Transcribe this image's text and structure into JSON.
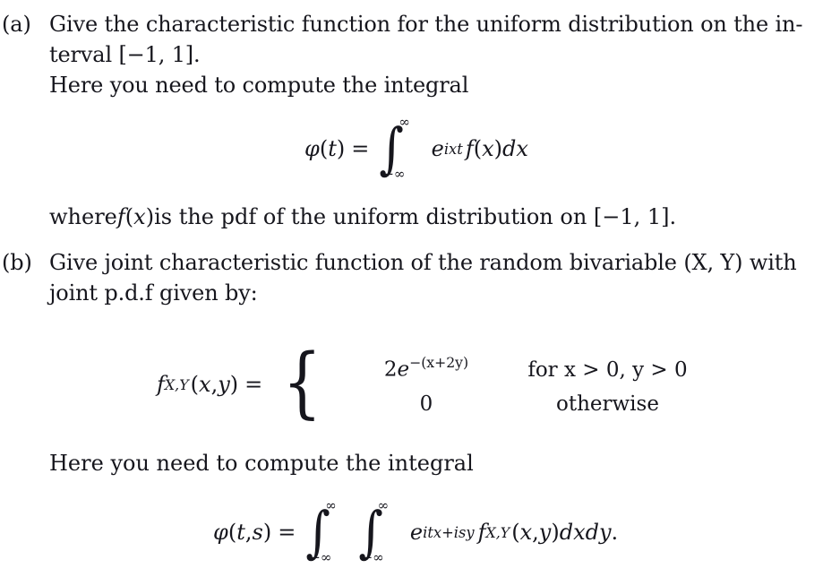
{
  "document": {
    "type": "math-exercise",
    "items": [
      {
        "label": "(a)",
        "lines": [
          "Give the characteristic function for the uniform distribution on the in-",
          "terval [−1, 1].",
          "Here you need to compute the integral"
        ],
        "trailing_line": "where f(x) is the pdf of the uniform distribution on [−1, 1]."
      },
      {
        "label": "(b)",
        "lines": [
          "Give joint characteristic function of the random bivariable (X, Y) with",
          "joint p.d.f given by:"
        ],
        "trailing_line": "Here you need to compute the integral"
      }
    ]
  },
  "equation_a": {
    "lhs_fn": "φ",
    "lhs_open": "(",
    "lhs_var": "t",
    "lhs_close": ")",
    "equals": "=",
    "integral_glyph": "∫",
    "upper_limit": "∞",
    "lower_limit": "−∞",
    "integrand_base": "e",
    "integrand_exponent": "ixt",
    "density": "f",
    "density_open": "(",
    "density_var": "x",
    "density_close": ")",
    "differential": "dx"
  },
  "where_clause": {
    "prefix": "where ",
    "fn": "f",
    "open": "(",
    "var": "x",
    "close": ")",
    "suffix": " is the pdf of the uniform distribution on [−1, 1]."
  },
  "piecewise": {
    "fn_name": "f",
    "fn_sub": "X,Y",
    "fn_args_open": "(",
    "fn_arg1": "x",
    "fn_comma": ", ",
    "fn_arg2": "y",
    "fn_args_close": ")",
    "equals": "=",
    "brace": "{",
    "rows": [
      {
        "value_coef": "2",
        "value_base": "e",
        "value_exp": "−(x+2y)",
        "condition": "for  x > 0, y > 0"
      },
      {
        "value_coef": "0",
        "value_base": "",
        "value_exp": "",
        "condition": "otherwise"
      }
    ]
  },
  "equation_b": {
    "lhs_fn": "φ",
    "lhs_open": "(",
    "lhs_var1": "t",
    "lhs_comma": ", ",
    "lhs_var2": "s",
    "lhs_close": ")",
    "equals": "=",
    "integral_glyph": "∫",
    "upper_limit": "∞",
    "lower_limit": "−∞",
    "integrand_base": "e",
    "integrand_exponent": "itx+isy",
    "density": "f",
    "density_sub": "X,Y",
    "density_open": "(",
    "density_var1": "x",
    "density_comma": ", ",
    "density_var2": "y",
    "density_close": ")",
    "differential": "dxdy",
    "terminator": "."
  },
  "style": {
    "text_color": "#16161d",
    "background": "#ffffff"
  }
}
